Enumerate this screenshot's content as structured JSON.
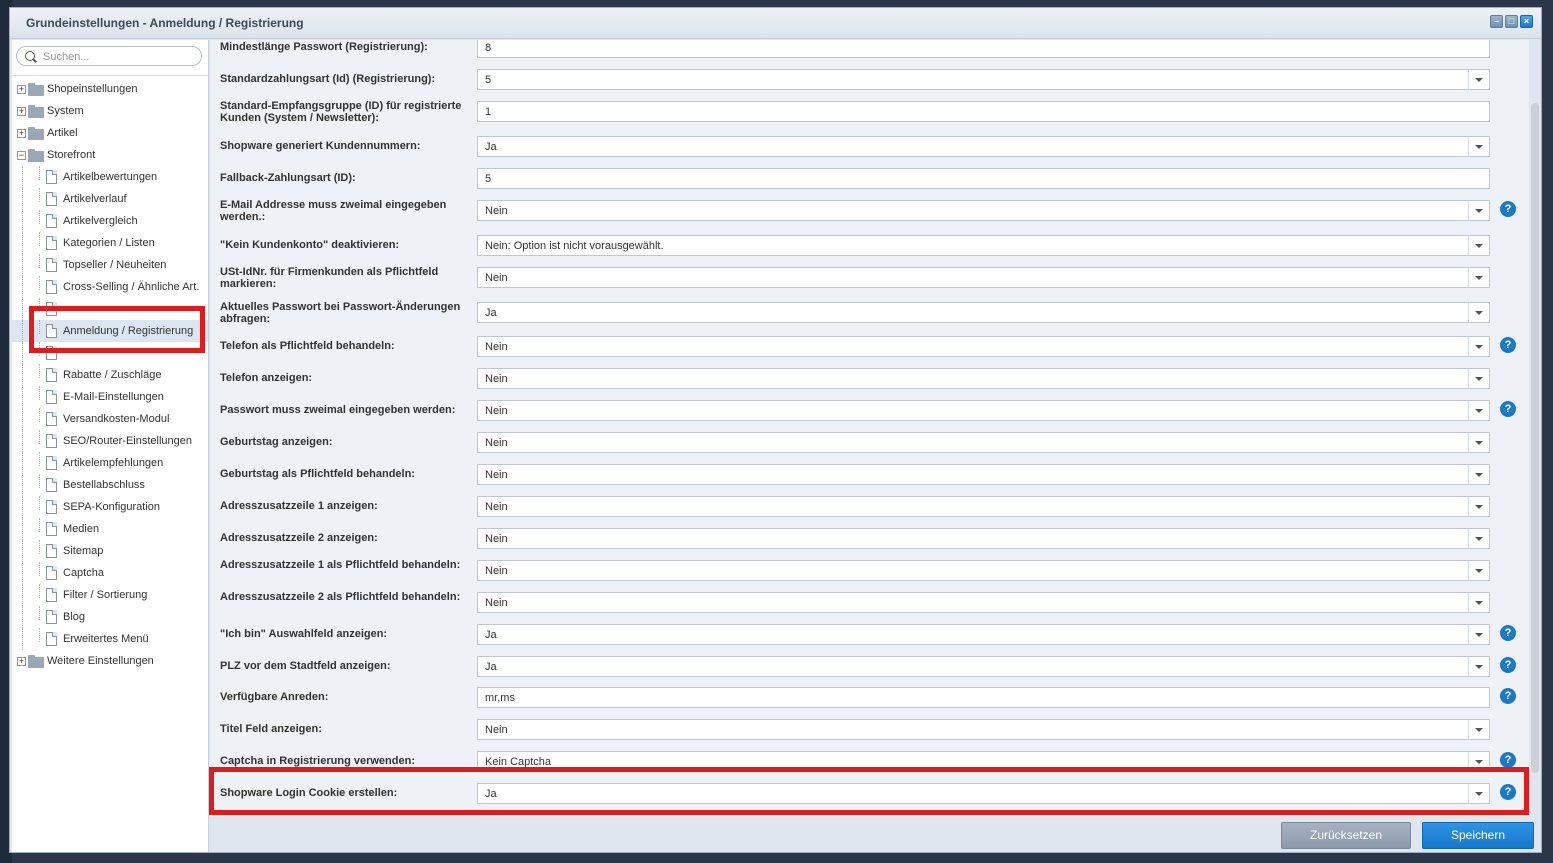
{
  "window": {
    "title": "Grundeinstellungen - Anmeldung / Registrierung",
    "controls": [
      "minimize",
      "maximize",
      "close"
    ]
  },
  "sidebar": {
    "search_placeholder": "Suchen...",
    "tree": [
      {
        "label": "Shopeinstellungen",
        "level": 0,
        "type": "folder",
        "expanded": false
      },
      {
        "label": "System",
        "level": 0,
        "type": "folder",
        "expanded": false
      },
      {
        "label": "Artikel",
        "level": 0,
        "type": "folder",
        "expanded": false
      },
      {
        "label": "Storefront",
        "level": 0,
        "type": "folder",
        "expanded": true
      },
      {
        "label": "Artikelbewertungen",
        "level": 1,
        "type": "page"
      },
      {
        "label": "Artikelverlauf",
        "level": 1,
        "type": "page"
      },
      {
        "label": "Artikelvergleich",
        "level": 1,
        "type": "page"
      },
      {
        "label": "Kategorien / Listen",
        "level": 1,
        "type": "page"
      },
      {
        "label": "Topseller / Neuheiten",
        "level": 1,
        "type": "page"
      },
      {
        "label": "Cross-Selling / Ähnliche Art.",
        "level": 1,
        "type": "page"
      },
      {
        "label": "",
        "level": 1,
        "type": "page"
      },
      {
        "label": "Anmeldung / Registrierung",
        "level": 1,
        "type": "page",
        "selected": true
      },
      {
        "label": "",
        "level": 1,
        "type": "page"
      },
      {
        "label": "Rabatte / Zuschläge",
        "level": 1,
        "type": "page"
      },
      {
        "label": "E-Mail-Einstellungen",
        "level": 1,
        "type": "page"
      },
      {
        "label": "Versandkosten-Modul",
        "level": 1,
        "type": "page"
      },
      {
        "label": "SEO/Router-Einstellungen",
        "level": 1,
        "type": "page"
      },
      {
        "label": "Artikelempfehlungen",
        "level": 1,
        "type": "page"
      },
      {
        "label": "Bestellabschluss",
        "level": 1,
        "type": "page"
      },
      {
        "label": "SEPA-Konfiguration",
        "level": 1,
        "type": "page"
      },
      {
        "label": "Medien",
        "level": 1,
        "type": "page"
      },
      {
        "label": "Sitemap",
        "level": 1,
        "type": "page"
      },
      {
        "label": "Captcha",
        "level": 1,
        "type": "page"
      },
      {
        "label": "Filter / Sortierung",
        "level": 1,
        "type": "page"
      },
      {
        "label": "Blog",
        "level": 1,
        "type": "page"
      },
      {
        "label": "Erweitertes Menü",
        "level": 1,
        "type": "page"
      },
      {
        "label": "Weitere Einstellungen",
        "level": 0,
        "type": "folder",
        "expanded": false
      }
    ]
  },
  "form": {
    "fields": [
      {
        "label": "Mindestlänge Passwort (Registrierung):",
        "value": "8",
        "type": "text",
        "help": false
      },
      {
        "label": "Standardzahlungsart (Id) (Registrierung):",
        "value": "5",
        "type": "combo",
        "help": false
      },
      {
        "label": "Standard-Empfangsgruppe (ID) für registrierte Kunden (System / Newsletter):",
        "value": "1",
        "type": "text",
        "help": false
      },
      {
        "label": "Shopware generiert Kundennummern:",
        "value": "Ja",
        "type": "combo",
        "help": false
      },
      {
        "label": "Fallback-Zahlungsart (ID):",
        "value": "5",
        "type": "text",
        "help": false
      },
      {
        "label": "E-Mail Addresse muss zweimal eingegeben werden.:",
        "value": "Nein",
        "type": "combo",
        "help": true
      },
      {
        "label": "\"Kein Kundenkonto\" deaktivieren:",
        "value": "Nein: Option ist nicht vorausgewählt.",
        "type": "combo",
        "help": false
      },
      {
        "label": "USt-IdNr. für Firmenkunden als Pflichtfeld markieren:",
        "value": "Nein",
        "type": "combo",
        "help": false
      },
      {
        "label": "Aktuelles Passwort bei Passwort-Änderungen abfragen:",
        "value": "Ja",
        "type": "combo",
        "help": false
      },
      {
        "label": "Telefon als Pflichtfeld behandeln:",
        "value": "Nein",
        "type": "combo",
        "help": true
      },
      {
        "label": "Telefon anzeigen:",
        "value": "Nein",
        "type": "combo",
        "help": false
      },
      {
        "label": "Passwort muss zweimal eingegeben werden:",
        "value": "Nein",
        "type": "combo",
        "help": true
      },
      {
        "label": "Geburtstag anzeigen:",
        "value": "Nein",
        "type": "combo",
        "help": false
      },
      {
        "label": "Geburtstag als Pflichtfeld behandeln:",
        "value": "Nein",
        "type": "combo",
        "help": false
      },
      {
        "label": "Adresszusatzzeile 1 anzeigen:",
        "value": "Nein",
        "type": "combo",
        "help": false
      },
      {
        "label": "Adresszusatzzeile 2 anzeigen:",
        "value": "Nein",
        "type": "combo",
        "help": false
      },
      {
        "label": "Adresszusatzzeile 1 als Pflichtfeld behandeln:",
        "value": "Nein",
        "type": "combo",
        "help": false
      },
      {
        "label": "Adresszusatzzeile 2 als Pflichtfeld behandeln:",
        "value": "Nein",
        "type": "combo",
        "help": false
      },
      {
        "label": "\"Ich bin\" Auswahlfeld anzeigen:",
        "value": "Ja",
        "type": "combo",
        "help": true
      },
      {
        "label": "PLZ vor dem Stadtfeld anzeigen:",
        "value": "Ja",
        "type": "combo",
        "help": true
      },
      {
        "label": "Verfügbare Anreden:",
        "value": "mr,ms",
        "type": "text",
        "help": true
      },
      {
        "label": "Titel Feld anzeigen:",
        "value": "Nein",
        "type": "combo",
        "help": false
      },
      {
        "label": "Captcha in Registrierung verwenden:",
        "value": "Kein Captcha",
        "type": "combo",
        "help": true
      },
      {
        "label": "Shopware Login Cookie erstellen:",
        "value": "Ja",
        "type": "combo",
        "help": true
      }
    ]
  },
  "footer": {
    "reset_label": "Zurücksetzen",
    "save_label": "Speichern"
  },
  "colors": {
    "accent": "#1b7ac5",
    "highlight": "#e01b1b"
  }
}
